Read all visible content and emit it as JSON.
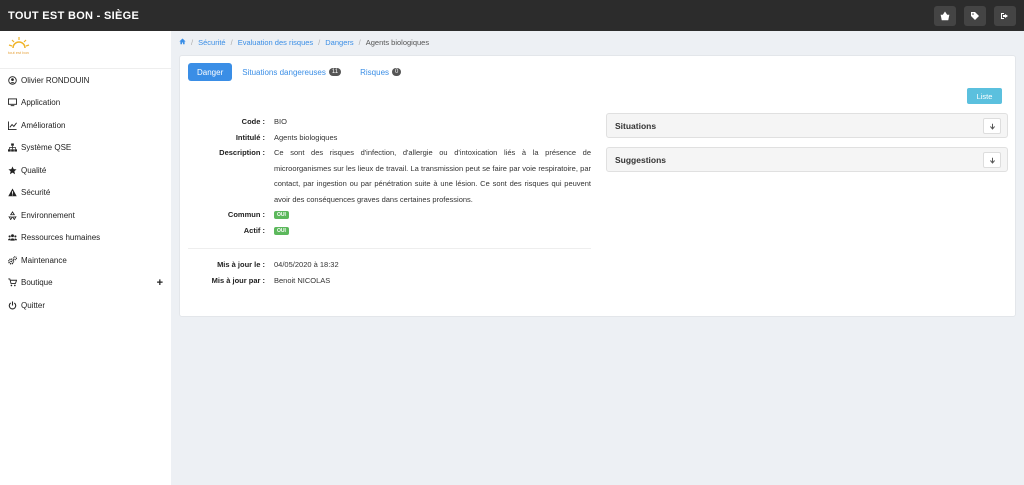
{
  "app": {
    "title": "TOUT EST BON - SIÈGE"
  },
  "topbar": {
    "icons": [
      "basket-icon",
      "tag-icon",
      "sign-out-icon"
    ]
  },
  "logo": {
    "text": "tout est bon"
  },
  "sidebar": {
    "items": [
      {
        "label": "Olivier RONDOUIN",
        "icon": "user-icon"
      },
      {
        "label": "Application",
        "icon": "desktop-icon"
      },
      {
        "label": "Amélioration",
        "icon": "chart-icon"
      },
      {
        "label": "Système QSE",
        "icon": "sitemap-icon"
      },
      {
        "label": "Qualité",
        "icon": "star-icon"
      },
      {
        "label": "Sécurité",
        "icon": "warning-icon"
      },
      {
        "label": "Environnement",
        "icon": "recycle-icon"
      },
      {
        "label": "Ressources humaines",
        "icon": "users-icon"
      },
      {
        "label": "Maintenance",
        "icon": "cogs-icon"
      },
      {
        "label": "Boutique",
        "icon": "cart-icon",
        "extra": "+"
      },
      {
        "label": "Quitter",
        "icon": "power-icon"
      }
    ]
  },
  "breadcrumb": {
    "items": [
      "Sécurité",
      "Evaluation des risques",
      "Dangers"
    ],
    "current": "Agents biologiques"
  },
  "tabs": [
    {
      "label": "Danger",
      "active": true
    },
    {
      "label": "Situations dangereuses",
      "badge": "11"
    },
    {
      "label": "Risques",
      "badge": "0"
    }
  ],
  "actions": {
    "liste_label": "Liste"
  },
  "details": {
    "code_label": "Code :",
    "code": "BIO",
    "intitule_label": "Intitulé :",
    "intitule": "Agents biologiques",
    "description_label": "Description :",
    "description": "Ce sont des risques d'infection, d'allergie ou d'intoxication liés à la présence de microorganismes sur les lieux de travail. La transmission peut se faire par voie respiratoire, par contact, par ingestion ou par pénétration suite à une lésion. Ce sont des risques qui peuvent avoir des conséquences graves dans certaines professions.",
    "commun_label": "Commun :",
    "commun": "OUI",
    "actif_label": "Actif :",
    "actif": "OUI",
    "updated_label": "Mis à jour le :",
    "updated": "04/05/2020 à 18:32",
    "updated_by_label": "Mis à jour par :",
    "updated_by": "Benoit NICOLAS"
  },
  "panels": {
    "situations": "Situations",
    "suggestions": "Suggestions"
  },
  "colors": {
    "primary": "#3a8ee6",
    "info": "#5bc0de",
    "success": "#5cb85c",
    "topbar": "#2c2c2c"
  }
}
